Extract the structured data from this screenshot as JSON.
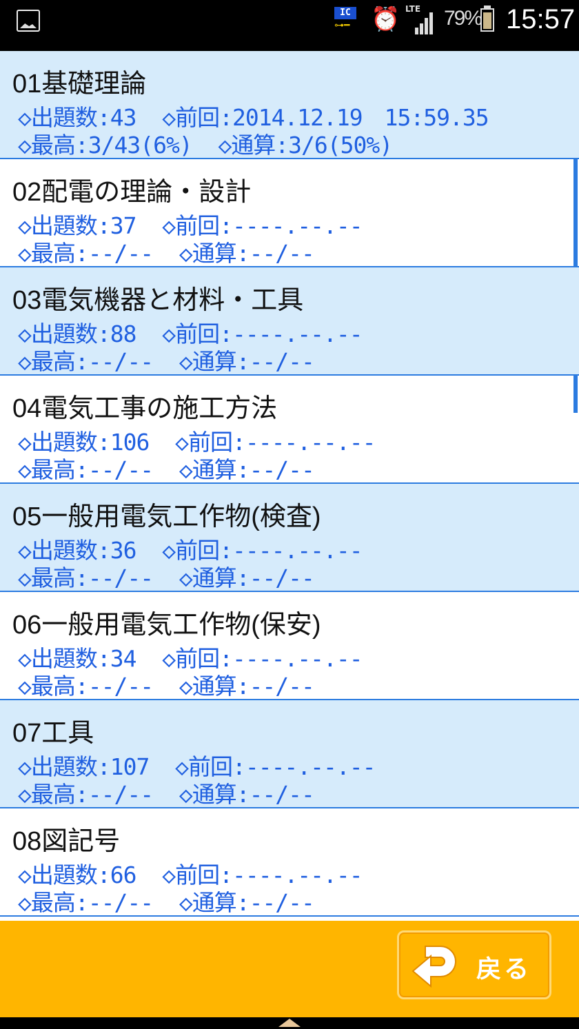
{
  "status_bar": {
    "ic_label": "IC",
    "lte_label": "LTE",
    "battery": "79%",
    "battery_level": 0.79,
    "time": "15:57"
  },
  "items": [
    {
      "title": "01基礎理論",
      "count": "◇出題数:43",
      "last": "◇前回:2014.12.19　15:59.35",
      "best": "◇最高:3/43(6%)",
      "total": "◇通算:3/6(50%)",
      "alt": true
    },
    {
      "title": "02配電の理論・設計",
      "count": "◇出題数:37",
      "last": "◇前回:----.--.--",
      "best": "◇最高:--/--",
      "total": "◇通算:--/--",
      "alt": false
    },
    {
      "title": "03電気機器と材料・工具",
      "count": "◇出題数:88",
      "last": "◇前回:----.--.--",
      "best": "◇最高:--/--",
      "total": "◇通算:--/--",
      "alt": true
    },
    {
      "title": "04電気工事の施工方法",
      "count": "◇出題数:106",
      "last": "◇前回:----.--.--",
      "best": "◇最高:--/--",
      "total": "◇通算:--/--",
      "alt": false
    },
    {
      "title": "05一般用電気工作物(検査)",
      "count": "◇出題数:36",
      "last": "◇前回:----.--.--",
      "best": "◇最高:--/--",
      "total": "◇通算:--/--",
      "alt": true
    },
    {
      "title": "06一般用電気工作物(保安)",
      "count": "◇出題数:34",
      "last": "◇前回:----.--.--",
      "best": "◇最高:--/--",
      "total": "◇通算:--/--",
      "alt": false
    },
    {
      "title": "07工具",
      "count": "◇出題数:107",
      "last": "◇前回:----.--.--",
      "best": "◇最高:--/--",
      "total": "◇通算:--/--",
      "alt": true
    },
    {
      "title": "08図記号",
      "count": "◇出題数:66",
      "last": "◇前回:----.--.--",
      "best": "◇最高:--/--",
      "total": "◇通算:--/--",
      "alt": false
    }
  ],
  "footer": {
    "back_label": "戻る"
  }
}
